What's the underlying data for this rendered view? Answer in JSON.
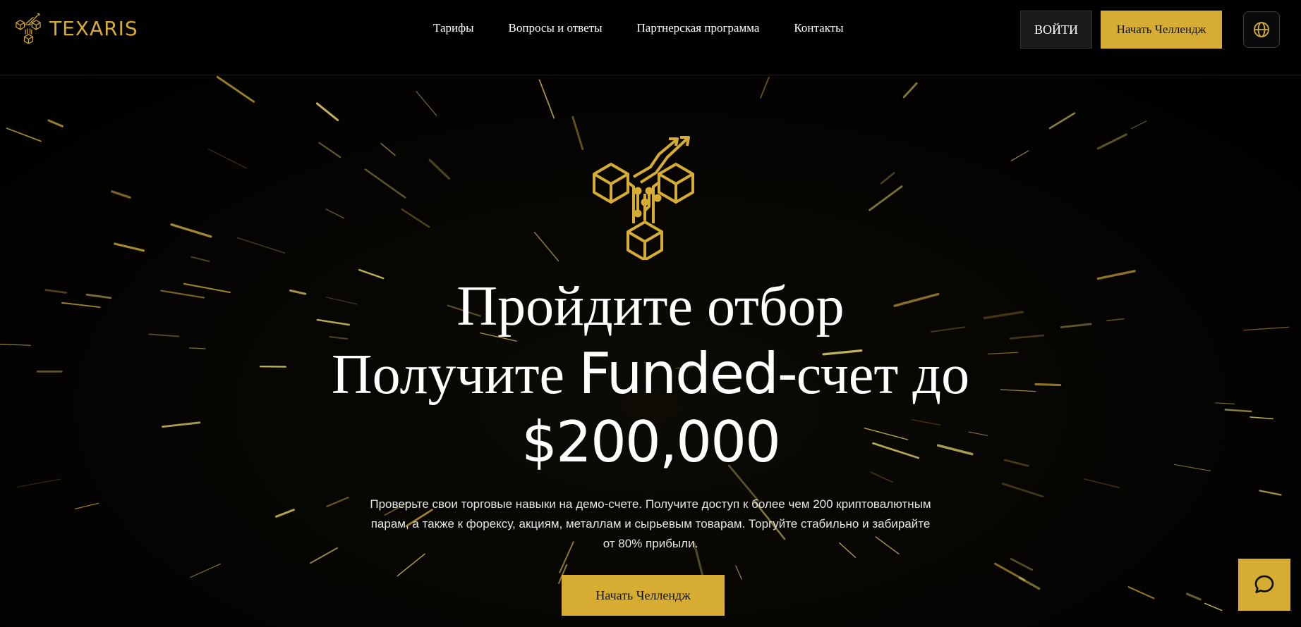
{
  "header": {
    "brand_name": "TEXARIS",
    "brand_logo_icon": "texaris-cube-logo-icon",
    "nav": [
      {
        "label": "Тарифы"
      },
      {
        "label": "Вопросы и ответы"
      },
      {
        "label": "Партнерская программа"
      },
      {
        "label": "Контакты"
      }
    ],
    "login_label": "ВОЙТИ",
    "cta_label": "Начать Челлендж",
    "language_icon": "globe-icon"
  },
  "hero": {
    "logo_icon": "texaris-cube-logo-icon",
    "title_line1": "Пройдите отбор",
    "title_line2_prefix": "Получите ",
    "title_line2_highlight": "Funded-",
    "title_line2_suffix": "счет до",
    "title_amount": "$200,000",
    "description": "Проверьте свои торговые навыки на демо-счете. Получите доступ к более чем 200 криптовалютным парам, а также к форексу, акциям, металлам и сырьевым товарам. Торгуйте стабильно и забирайте от 80% прибыли.",
    "cta_label": "Начать Челлендж"
  },
  "chat_widget": {
    "icon": "chat-bubble-icon"
  },
  "colors": {
    "accent_gold": "#d6ad32",
    "background": "#000000",
    "text": "#ffffff"
  }
}
